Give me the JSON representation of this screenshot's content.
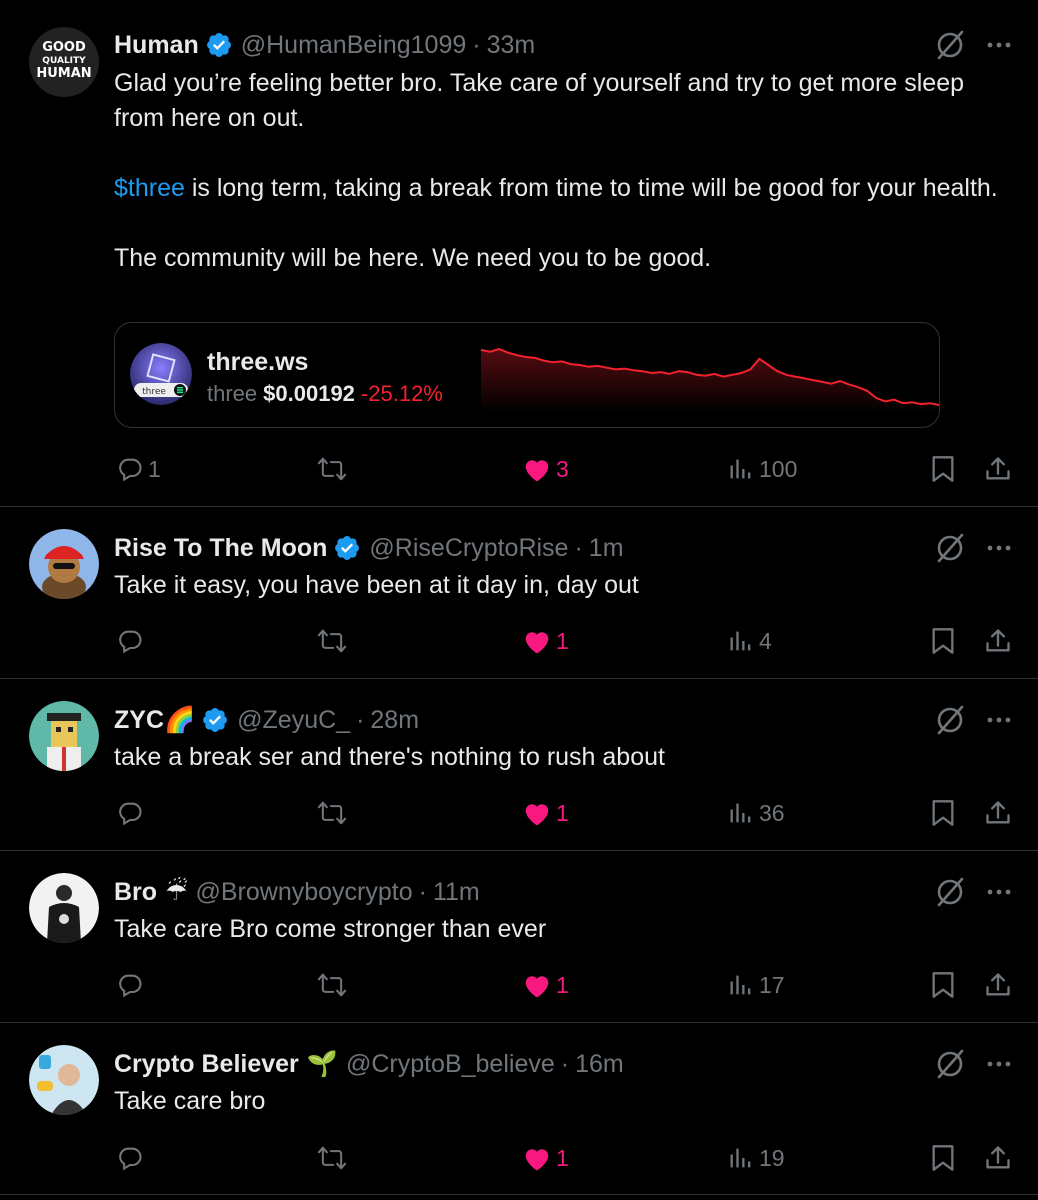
{
  "tweets": [
    {
      "name": "Human",
      "handle": "@HumanBeing1099",
      "separator": "·",
      "time": "33m",
      "verified": true,
      "avatar_text": [
        "GOOD",
        "QUALITY",
        "HUMAN"
      ],
      "text_line1": "Glad you’re feeling better bro. Take care of yourself and try to get more sleep from here on out.",
      "cashtag": "$three",
      "text_line2_rest": " is long term, taking a break from time to time will be good for your health.",
      "text_line3": "The community will be here. We need you to be good.",
      "card": {
        "name": "three.ws",
        "ticker": "three",
        "price": "$0.00192",
        "change": "-25.12%",
        "logo_text": "three",
        "chart_series": [
          72,
          70,
          73,
          69,
          66,
          64,
          63,
          60,
          58,
          59,
          56,
          55,
          53,
          54,
          52,
          50,
          51,
          49,
          48,
          46,
          47,
          45,
          48,
          47,
          44,
          43,
          45,
          42,
          44,
          46,
          50,
          62,
          55,
          48,
          44,
          42,
          40,
          38,
          36,
          34,
          37,
          33,
          30,
          26,
          18,
          14,
          16,
          12,
          13,
          11,
          12,
          10
        ]
      },
      "replies": "1",
      "likes": "3",
      "views": "100"
    },
    {
      "name": "Rise To The Moon",
      "handle": "@RiseCryptoRise",
      "separator": "·",
      "time": "1m",
      "verified": true,
      "text": "Take it easy, you have been at it day in, day out",
      "replies": "",
      "likes": "1",
      "views": "4"
    },
    {
      "name": "ZYC",
      "name_emoji": "🌈",
      "handle": "@ZeyuC_",
      "separator": "·",
      "time": "28m",
      "verified": true,
      "text": "take a break ser and there's nothing to rush about",
      "replies": "",
      "likes": "1",
      "views": "36"
    },
    {
      "name": "Bro",
      "name_emoji": "☔",
      "handle": "@Brownyboycrypto",
      "separator": "·",
      "time": "11m",
      "verified": false,
      "text": "Take care Bro come stronger than ever",
      "replies": "",
      "likes": "1",
      "views": "17"
    },
    {
      "name": "Crypto Believer",
      "name_emoji": "🌱",
      "handle": "@CryptoB_believe",
      "separator": "·",
      "time": "16m",
      "verified": false,
      "text": "Take care bro",
      "replies": "",
      "likes": "1",
      "views": "19"
    }
  ],
  "colors": {
    "background": "#000000",
    "text": "#e7e9ea",
    "muted": "#71767b",
    "like": "#f91880",
    "link": "#1d9bf0",
    "verified": "#1d9bf0",
    "negative": "#f4212e"
  },
  "icons": [
    "reply-icon",
    "retweet-icon",
    "heart-icon",
    "views-icon",
    "bookmark-icon",
    "share-icon",
    "grok-icon",
    "more-icon",
    "verified-badge-icon"
  ]
}
